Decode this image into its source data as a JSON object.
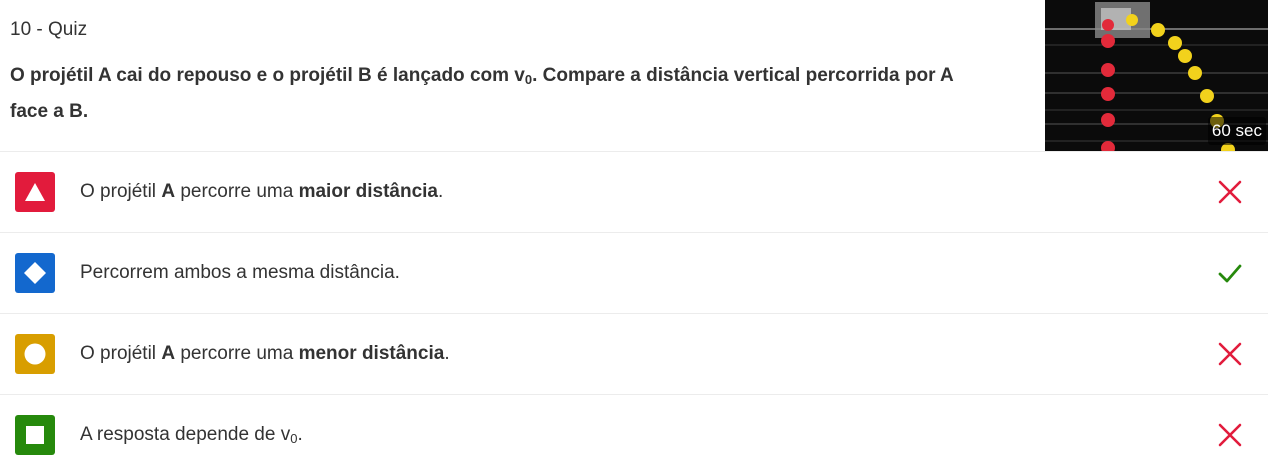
{
  "header": {
    "quiz_label": "10 - Quiz",
    "question_pre": "O projétil A cai do repouso e o projétil B é lançado com v",
    "question_sub": "0",
    "question_post": ". Compare a distância vertical percorrida por A face a B."
  },
  "media": {
    "timer": "60 sec"
  },
  "answers": [
    {
      "shape": "triangle-icon",
      "color": "#e21b3c",
      "text_a": "O projétil ",
      "text_b": "A",
      "text_c": " percorre uma ",
      "text_d": "maior distância",
      "text_e": ".",
      "result": "incorrect"
    },
    {
      "shape": "diamond-icon",
      "color": "#1368ce",
      "text_a": "Percorrem ambos a mesma distância.",
      "result": "correct"
    },
    {
      "shape": "circle-icon",
      "color": "#d89e00",
      "text_a": "O projétil ",
      "text_b": "A",
      "text_c": " percorre uma ",
      "text_d": "menor distância",
      "text_e": ".",
      "result": "incorrect"
    },
    {
      "shape": "square-icon",
      "color": "#26890c",
      "text_a": "A resposta depende de v",
      "text_sub": "0",
      "text_e": ".",
      "result": "incorrect"
    }
  ],
  "colors": {
    "incorrect": "#e21b3c",
    "correct": "#26890c"
  }
}
